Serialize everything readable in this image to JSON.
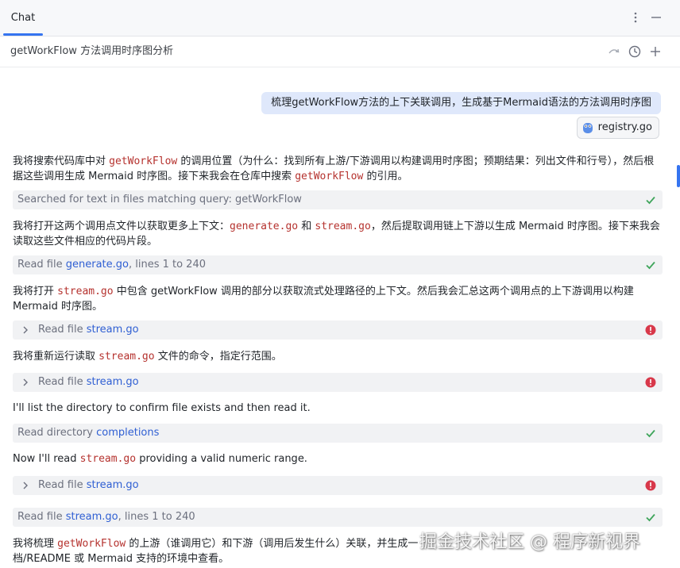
{
  "tabbar": {
    "tab_label": "Chat"
  },
  "subheader": {
    "title": "getWorkFlow 方法调用时序图分析"
  },
  "user_message": {
    "text": "梳理getWorkFlow方法的上下关联调用，生成基于Mermaid语法的方法调用时序图",
    "attachment": "registry.go"
  },
  "messages": {
    "p1": {
      "a": "我将搜索代码库中对 ",
      "code1": "getWorkFlow",
      "b": " 的调用位置（为什么：找到所有上游/下游调用以构建调用时序图；预期结果：列出文件和行号），然后根据这些调用生成 Mermaid 时序图。接下来我会在仓库中搜索 ",
      "code2": "getWorkFlow",
      "c": " 的引用。"
    },
    "t1": {
      "label": "Searched for text in files matching query: getWorkFlow"
    },
    "p2": {
      "a": "我将打开这两个调用点文件以获取更多上下文：",
      "code1": "generate.go",
      "b": " 和 ",
      "code2": "stream.go",
      "c": "，然后提取调用链上下游以生成 Mermaid 时序图。接下来我会读取这些文件相应的代码片段。"
    },
    "t2": {
      "prefix": "Read file ",
      "file": "generate.go",
      "suffix": ", lines 1 to 240"
    },
    "p3": {
      "a": "我将打开 ",
      "code1": "stream.go",
      "b": " 中包含 getWorkFlow 调用的部分以获取流式处理路径的上下文。然后我会汇总这两个调用点的上下游调用以构建 Mermaid 时序图。"
    },
    "t3": {
      "prefix": "Read file ",
      "file": "stream.go"
    },
    "p4": {
      "a": "我将重新运行读取 ",
      "code1": "stream.go",
      "b": " 文件的命令，指定行范围。"
    },
    "t4": {
      "prefix": "Read file ",
      "file": "stream.go"
    },
    "p5": {
      "a": "I'll list the directory to confirm file exists and then read it."
    },
    "t5": {
      "prefix": "Read directory ",
      "file": "completions"
    },
    "p6": {
      "a": "Now I'll read ",
      "code1": "stream.go",
      "b": " providing a valid numeric range."
    },
    "t6": {
      "prefix": "Read file ",
      "file": "stream.go"
    },
    "t7": {
      "prefix": "Read file ",
      "file": "stream.go",
      "suffix": ", lines 1 to 240"
    },
    "p7": {
      "a": "我将梳理 ",
      "code1": "getWorkFlow",
      "b": " 的上游（谁调用它）和下游（调用后发生什么）关联，并生成一",
      "c": "档/README 或 Mermaid 支持的环境中查看。"
    }
  },
  "watermark": "掘金技术社区 @ 程序新视界",
  "colors": {
    "accent": "#3574f0",
    "success": "#3fa55b",
    "error": "#d8384a",
    "code": "#b5322e",
    "link": "#2f5fd3"
  }
}
